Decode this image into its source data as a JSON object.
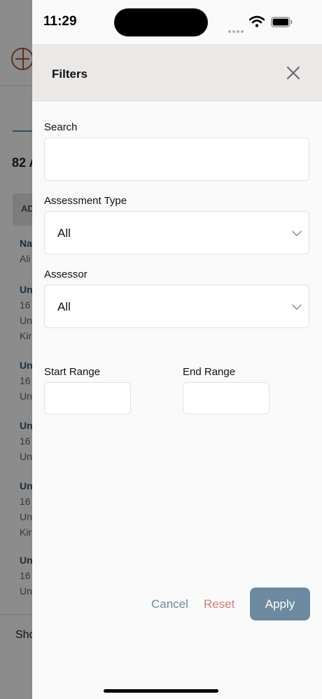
{
  "status_bar": {
    "time": "11:29"
  },
  "background": {
    "count_label": "82 A",
    "button_label": "AD",
    "cards": [
      {
        "title": "Na",
        "lines": [
          "Ali"
        ]
      },
      {
        "title": "Un",
        "lines": [
          "16",
          "Un",
          "Kir"
        ]
      },
      {
        "title": "Un",
        "lines": [
          "16",
          "Un"
        ]
      },
      {
        "title": "Un",
        "lines": [
          "16",
          "Un"
        ]
      },
      {
        "title": "Un",
        "lines": [
          "16",
          "Un",
          "Kir"
        ]
      },
      {
        "title": "Un",
        "lines": [
          "16",
          "Un"
        ]
      }
    ],
    "footer_text": "Sho"
  },
  "filters": {
    "title": "Filters",
    "search": {
      "label": "Search",
      "value": "",
      "placeholder": ""
    },
    "assessment_type": {
      "label": "Assessment Type",
      "value": "All"
    },
    "assessor": {
      "label": "Assessor",
      "value": "All"
    },
    "start_range": {
      "label": "Start Range",
      "value": ""
    },
    "end_range": {
      "label": "End Range",
      "value": ""
    },
    "cancel_label": "Cancel",
    "reset_label": "Reset",
    "apply_label": "Apply"
  },
  "colors": {
    "accent": "#6d8aa0",
    "reset": "#e07a74",
    "header_bg": "#ebe8e8",
    "brand": "#b5543a"
  },
  "icons": [
    "close-icon",
    "chevron-down-icon",
    "wifi-icon",
    "battery-icon",
    "signal-icon"
  ]
}
